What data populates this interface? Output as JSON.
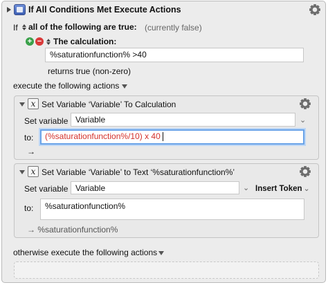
{
  "colors": {
    "add": "#3aa14a",
    "remove": "#d93a3a",
    "focus": "#6aa3e8",
    "calc_text": "#d3312b"
  },
  "header": {
    "title": "If All Conditions Met Execute Actions",
    "gear_icon": "gear-icon"
  },
  "condition": {
    "if_label": "If",
    "quantifier": "all of the following are true:",
    "status": "(currently false)",
    "calc_label": "The calculation:",
    "calc_value": "%saturationfunction% >40",
    "returns": "returns true (non-zero)"
  },
  "execute_label": "execute the following actions",
  "action1": {
    "title": "Set Variable ‘Variable’ To Calculation",
    "set_label": "Set variable",
    "variable": "Variable",
    "to_label": "to:",
    "to_value": "(%saturationfunction%/10) x 40",
    "arrow": "→"
  },
  "action2": {
    "title": "Set Variable ‘Variable’ to Text ‘%saturationfunction%’",
    "set_label": "Set variable",
    "variable": "Variable",
    "insert_token": "Insert Token",
    "to_label": "to:",
    "to_value": "%saturationfunction%",
    "result": "→ %saturationfunction%"
  },
  "otherwise_label": "otherwise execute the following actions"
}
